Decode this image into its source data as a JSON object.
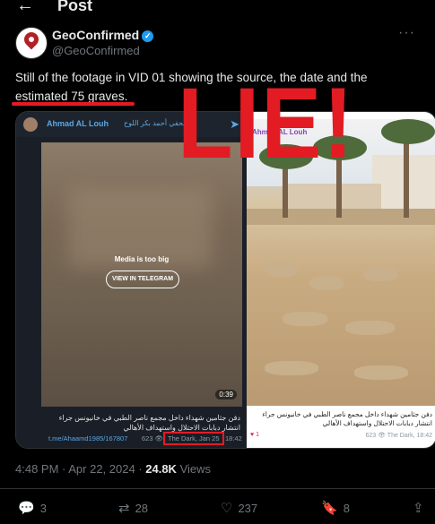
{
  "header": {
    "back_icon": "arrow-left-icon",
    "title": "Post"
  },
  "author": {
    "name": "GeoConfirmed",
    "handle": "@GeoConfirmed",
    "verified": true
  },
  "tweet": {
    "text": "Still of the footage in VID 01 showing the source, the date and the estimated 75 graves."
  },
  "overlay": {
    "text": "LIE!",
    "color": "#e31b23"
  },
  "telegram": {
    "channel_name": "Ahmad AL Louh",
    "channel_arabic": "الصحفي أحمد بكر اللوح",
    "media_notice": "Media is too big",
    "view_button": "VIEW IN TELEGRAM",
    "duration": "0:39",
    "caption": "دفن جثامين شهداء داخل مجمع ناصر الطبي في خانيونس جراء انتشار دبابات الاحتلال واستهداف الأهالي",
    "link": "t.me/Ahaamd1985/167807",
    "views": "623",
    "date": "The Dark, Jan 25",
    "time": "18:42"
  },
  "right_panel": {
    "top_label": "Ahmad AL Louh",
    "caption": "دفن جثامين شهداء داخل مجمع ناصر الطبي في خانيونس جراء انتشار دبابات الاحتلال واستهداف الأهالي",
    "reactions": "1",
    "views": "623",
    "date": "The Dark, 18:42"
  },
  "meta": {
    "time": "4:48 PM · Apr 22, 2024 · ",
    "views_count": "24.8K",
    "views_label": " Views"
  },
  "actions": {
    "replies": "3",
    "reposts": "28",
    "likes": "237",
    "bookmarks": "8"
  }
}
